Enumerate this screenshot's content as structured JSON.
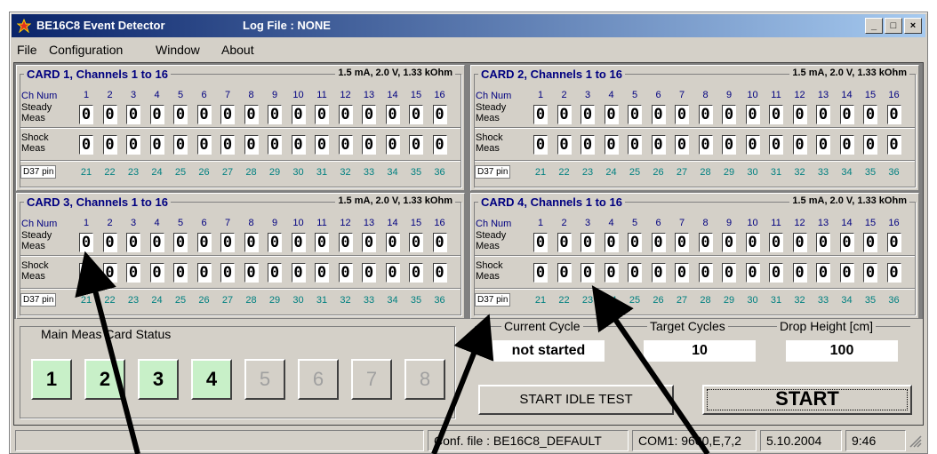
{
  "window": {
    "title": "BE16C8 Event Detector",
    "log_file": "Log File : NONE",
    "controls": {
      "minimize": "_",
      "maximize": "□",
      "close": "×"
    }
  },
  "menu": [
    "File",
    "Configuration",
    "Window",
    "About"
  ],
  "card_common": {
    "params": "1.5 mA,  2.0 V,  1.33 kOhm",
    "ch_num_label": "Ch Num",
    "steady_label_1": "Steady",
    "steady_label_2": "Meas",
    "shock_label_1": "Shock",
    "shock_label_2": "Meas",
    "pin_label": "D37 pin",
    "channels": [
      "1",
      "2",
      "3",
      "4",
      "5",
      "6",
      "7",
      "8",
      "9",
      "10",
      "11",
      "12",
      "13",
      "14",
      "15",
      "16"
    ],
    "pins": [
      "21",
      "22",
      "23",
      "24",
      "25",
      "26",
      "27",
      "28",
      "29",
      "30",
      "31",
      "32",
      "33",
      "34",
      "35",
      "36"
    ],
    "steady_values": [
      "0",
      "0",
      "0",
      "0",
      "0",
      "0",
      "0",
      "0",
      "0",
      "0",
      "0",
      "0",
      "0",
      "0",
      "0",
      "0"
    ],
    "shock_values": [
      "0",
      "0",
      "0",
      "0",
      "0",
      "0",
      "0",
      "0",
      "0",
      "0",
      "0",
      "0",
      "0",
      "0",
      "0",
      "0"
    ]
  },
  "cards": [
    {
      "title": "CARD 1, Channels  1 to 16"
    },
    {
      "title": "CARD 2, Channels  1 to 16"
    },
    {
      "title": "CARD 3, Channels  1 to 16"
    },
    {
      "title": "CARD 4, Channels  1 to 16"
    }
  ],
  "status": {
    "title": "Main Meas Card Status",
    "buttons": [
      {
        "label": "1",
        "active": true
      },
      {
        "label": "2",
        "active": true
      },
      {
        "label": "3",
        "active": true
      },
      {
        "label": "4",
        "active": true
      },
      {
        "label": "5",
        "active": false
      },
      {
        "label": "6",
        "active": false
      },
      {
        "label": "7",
        "active": false
      },
      {
        "label": "8",
        "active": false
      }
    ]
  },
  "current_cycle": {
    "label": "Current Cycle",
    "value": "not started"
  },
  "target_cycles": {
    "label": "Target Cycles",
    "value": "10"
  },
  "drop_height": {
    "label": "Drop Height [cm]",
    "value": "100"
  },
  "start_idle_label": "START IDLE TEST",
  "start_label": "START",
  "statusbar": {
    "conf": "Conf. file : BE16C8_DEFAULT",
    "com": "COM1: 9600,E,7,2",
    "date": "5.10.2004",
    "time": "9:46"
  },
  "colors": {
    "active_card": "#c8f0c8",
    "title_blue": "#000080",
    "pin_teal": "#008080"
  }
}
